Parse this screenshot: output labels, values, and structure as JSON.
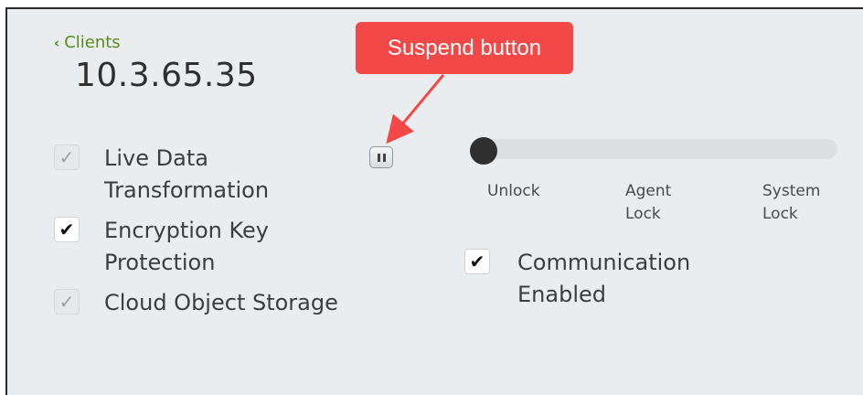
{
  "header": {
    "back_link": "Clients",
    "title": "10.3.65.35"
  },
  "options": [
    {
      "label_line1": "Live Data",
      "label_line2": "Transformation",
      "checked": true,
      "enabled": false
    },
    {
      "label_line1": "Encryption Key",
      "label_line2": "Protection",
      "checked": true,
      "enabled": true
    },
    {
      "label_line1": "Cloud Object Storage",
      "label_line2": "",
      "checked": true,
      "enabled": false
    }
  ],
  "lock_slider": {
    "value": 0,
    "labels": [
      {
        "line1": "Unlock",
        "line2": ""
      },
      {
        "line1": "Agent",
        "line2": "Lock"
      },
      {
        "line1": "System",
        "line2": "Lock"
      }
    ]
  },
  "communication": {
    "label_line1": "Communication",
    "label_line2": "Enabled",
    "checked": true
  },
  "annotation": {
    "text": "Suspend button",
    "color": "#f24848"
  },
  "colors": {
    "accent_link": "#5a8a1a",
    "background": "#eaedf0"
  },
  "icons": {
    "back": "chevron-left-icon",
    "suspend": "pause-icon",
    "check": "checkmark-icon"
  }
}
